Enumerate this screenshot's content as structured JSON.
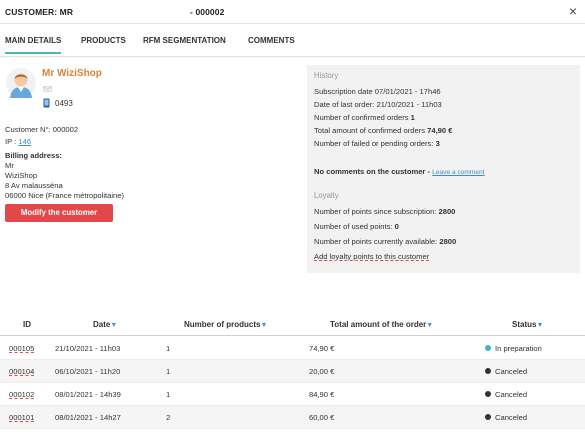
{
  "header": {
    "title_prefix": "CUSTOMER: MR",
    "title_suffix": "- 000002",
    "close_glyph": "×"
  },
  "tabs": [
    {
      "label": "MAIN DETAILS",
      "active": true
    },
    {
      "label": "PRODUCTS",
      "active": false
    },
    {
      "label": "RFM SEGMENTATION",
      "active": false
    },
    {
      "label": "COMMENTS",
      "active": false
    }
  ],
  "customer": {
    "name": "Mr WiziShop",
    "phone": "0493",
    "customer_no": "Customer N°: 000002",
    "ip_label": "IP : ",
    "ip_value": "146",
    "billing_title": "Billing address:",
    "billing_lines": [
      "Mr",
      "WiziShop",
      "8 Av malausséna",
      "06000 Nice (France métropolitaine)"
    ],
    "modify_label": "Modify the customer"
  },
  "history": {
    "title": "History",
    "subscription": "Subscription date 07/01/2021 - 17h46",
    "last_order": "Date of last order: 21/10/2021 - 11h03",
    "confirmed_label": "Number of confirmed orders ",
    "confirmed_value": "1",
    "total_label": "Total amount of confirmed orders ",
    "total_value": "74,90 €",
    "failed_label": "Number of failed or pending orders: ",
    "failed_value": "3"
  },
  "comments": {
    "text": "No comments on the customer - ",
    "link": "Leave a comment"
  },
  "loyalty": {
    "title": "Loyalty",
    "since_label": "Number of points since subscription: ",
    "since_value": "2800",
    "used_label": "Number of used points: ",
    "used_value": "0",
    "available_label": "Number of points currently available: ",
    "available_value": "2800",
    "add_link": "Add loyalty points to this customer"
  },
  "orders": {
    "columns": [
      "ID",
      "Date",
      "Number of products",
      "Total amount of the order",
      "Status"
    ],
    "rows": [
      {
        "id": "000105",
        "date": "21/10/2021 - 11h03",
        "products": "1",
        "total": "74,90 €",
        "status": "In preparation",
        "status_color": "#3bb4c6"
      },
      {
        "id": "000104",
        "date": "06/10/2021 - 11h20",
        "products": "1",
        "total": "20,00 €",
        "status": "Canceled",
        "status_color": "#333333"
      },
      {
        "id": "000102",
        "date": "08/01/2021 - 14h39",
        "products": "1",
        "total": "84,90 €",
        "status": "Canceled",
        "status_color": "#333333"
      },
      {
        "id": "000101",
        "date": "08/01/2021 - 14h27",
        "products": "2",
        "total": "60,00 €",
        "status": "Canceled",
        "status_color": "#333333"
      }
    ]
  },
  "colors": {
    "accent_tab": "#4db6ac",
    "name": "#d8833a",
    "button": "#e2474a",
    "link": "#3a8dc8"
  },
  "icons": [
    "avatar",
    "mail-icon",
    "phone-icon",
    "close-icon",
    "chevron-down-icon"
  ]
}
